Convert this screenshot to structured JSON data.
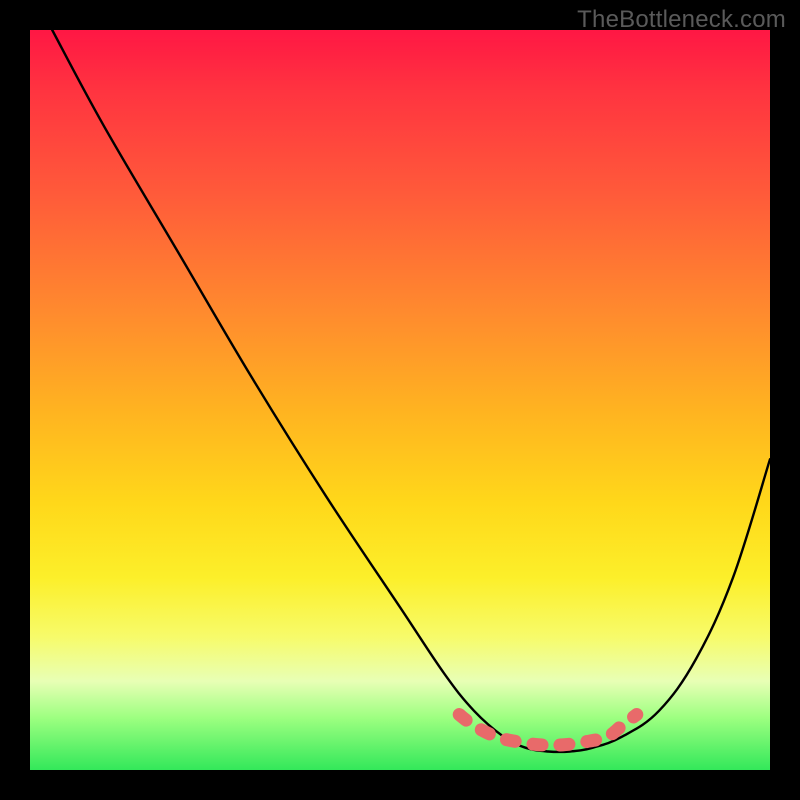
{
  "watermark": "TheBottleneck.com",
  "chart_data": {
    "type": "line",
    "title": "",
    "xlabel": "",
    "ylabel": "",
    "xlim": [
      0,
      100
    ],
    "ylim": [
      0,
      100
    ],
    "grid": false,
    "legend": false,
    "series": [
      {
        "name": "bottleneck-curve",
        "color": "#000000",
        "x": [
          3,
          10,
          20,
          30,
          40,
          50,
          56,
          60,
          64,
          67,
          70,
          73,
          76,
          80,
          85,
          90,
          95,
          100
        ],
        "values": [
          100,
          87,
          70,
          53,
          37,
          22,
          13,
          8,
          4.5,
          3,
          2.5,
          2.5,
          3,
          4.5,
          8,
          15,
          26,
          42
        ]
      },
      {
        "name": "optimal-band",
        "color": "#e86a6a",
        "style": "thick-dashes",
        "x": [
          58,
          60,
          63,
          66,
          69,
          72,
          75,
          78,
          80,
          82
        ],
        "values": [
          7.5,
          6,
          4.5,
          3.8,
          3.4,
          3.4,
          3.8,
          4.5,
          6,
          7.5
        ]
      }
    ],
    "annotations": []
  }
}
